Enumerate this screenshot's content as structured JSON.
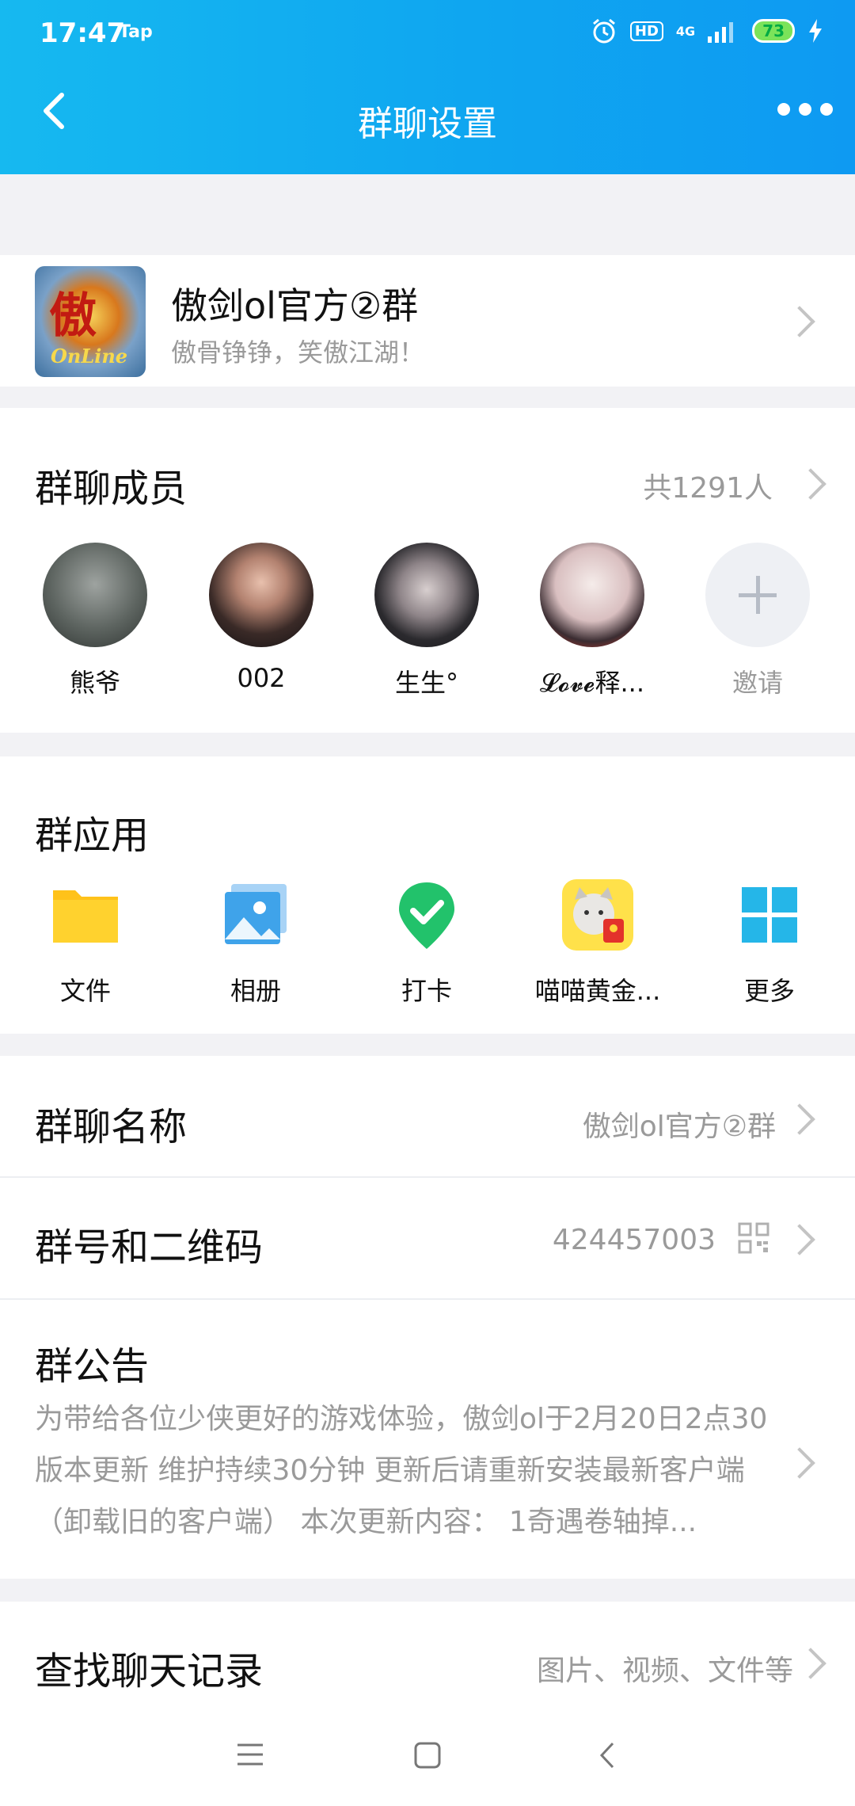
{
  "status_bar": {
    "time": "17:47",
    "carrier": "Tap",
    "hd": "HD",
    "network": "4G",
    "battery": "73"
  },
  "navbar": {
    "title": "群聊设置"
  },
  "group": {
    "name": "傲剑ol官方②群",
    "description": "傲骨铮铮，笑傲江湖！",
    "avatar_text_main": "傲",
    "avatar_text_sub": "OnLine"
  },
  "members": {
    "title": "群聊成员",
    "count": "共1291人",
    "items": [
      {
        "name": "熊爷"
      },
      {
        "name": "002"
      },
      {
        "name": "生生°"
      },
      {
        "name": "𝓛𝓸𝓿𝓮释..."
      }
    ],
    "invite_label": "邀请"
  },
  "apps": {
    "title": "群应用",
    "items": [
      {
        "label": "文件"
      },
      {
        "label": "相册"
      },
      {
        "label": "打卡"
      },
      {
        "label": "喵喵黄金..."
      },
      {
        "label": "更多"
      }
    ]
  },
  "settings": {
    "name_label": "群聊名称",
    "name_value": "傲剑ol官方②群",
    "id_label": "群号和二维码",
    "id_value": "424457003",
    "notice_label": "群公告",
    "notice_text": "为带给各位少侠更好的游戏体验，傲剑ol于2月20日2点30版本更新 维护持续30分钟 更新后请重新安装最新客户端（卸载旧的客户端） 本次更新内容：  1奇遇卷轴掉...",
    "search_label": "查找聊天记录",
    "search_value": "图片、视频、文件等"
  },
  "colors": {
    "header_start": "#16b9f0",
    "header_end": "#0e9af2",
    "secondary_text": "#9a9a9a",
    "checkin_green": "#22c26b",
    "file_yellow": "#ffc21a",
    "album_blue": "#3fa3ea",
    "more_cyan": "#25b6e8"
  }
}
